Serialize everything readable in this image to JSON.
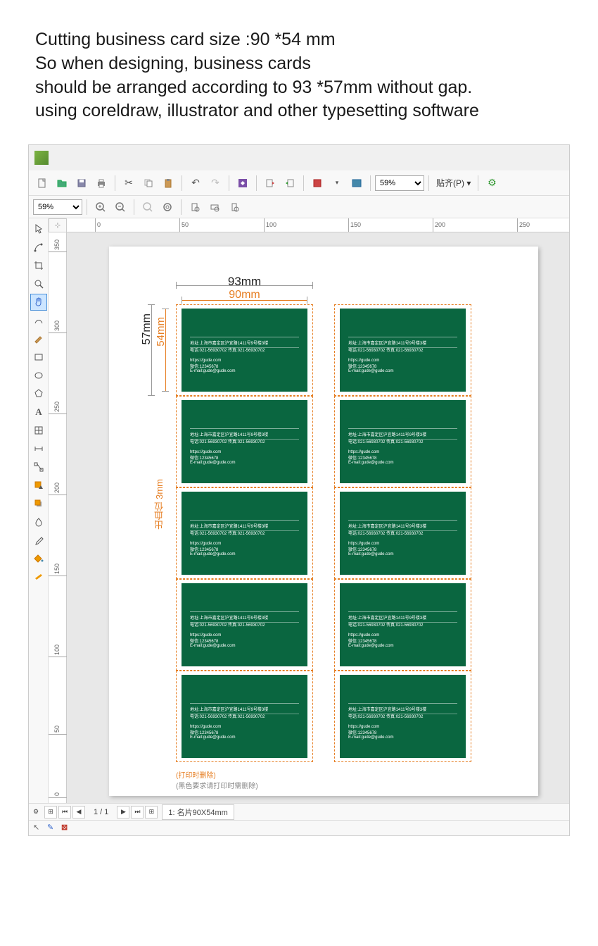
{
  "header": {
    "line1": "Cutting business card size :90 *54 mm",
    "line2": "So when designing, business cards",
    "line3": " should be arranged according to 93 *57mm without gap.",
    "line4": "using coreldraw, illustrator and other typesetting software"
  },
  "toolbar": {
    "zoom1": "59%",
    "zoom2": "59%",
    "snap": "贴齐(P)"
  },
  "ruler_h": [
    "0",
    "50",
    "100",
    "150",
    "200",
    "250"
  ],
  "ruler_v": [
    "350",
    "300",
    "250",
    "200",
    "150",
    "100",
    "50",
    "0"
  ],
  "dims": {
    "w_outer": "93mm",
    "w_inner": "90mm",
    "h_outer": "57mm",
    "h_inner": "54mm",
    "bleed": "出血位 3mm"
  },
  "card_text": {
    "l1": "地址:上海市嘉定区沪宜路1411号9号楼3楼",
    "l2": "电话:021-56930702    传真:021-56930702",
    "l3": "https://gude.com",
    "l4": "微信:12345678",
    "l5": "E-mail:gude@gude.com"
  },
  "footer": {
    "note_orange": "(打印时删除)",
    "note_gray": "(黑色要求请打印时需删除)"
  },
  "status": {
    "pages": "1 / 1",
    "tab": "1: 名片90X54mm"
  },
  "layout": {
    "rows": 5,
    "cols": 2
  }
}
